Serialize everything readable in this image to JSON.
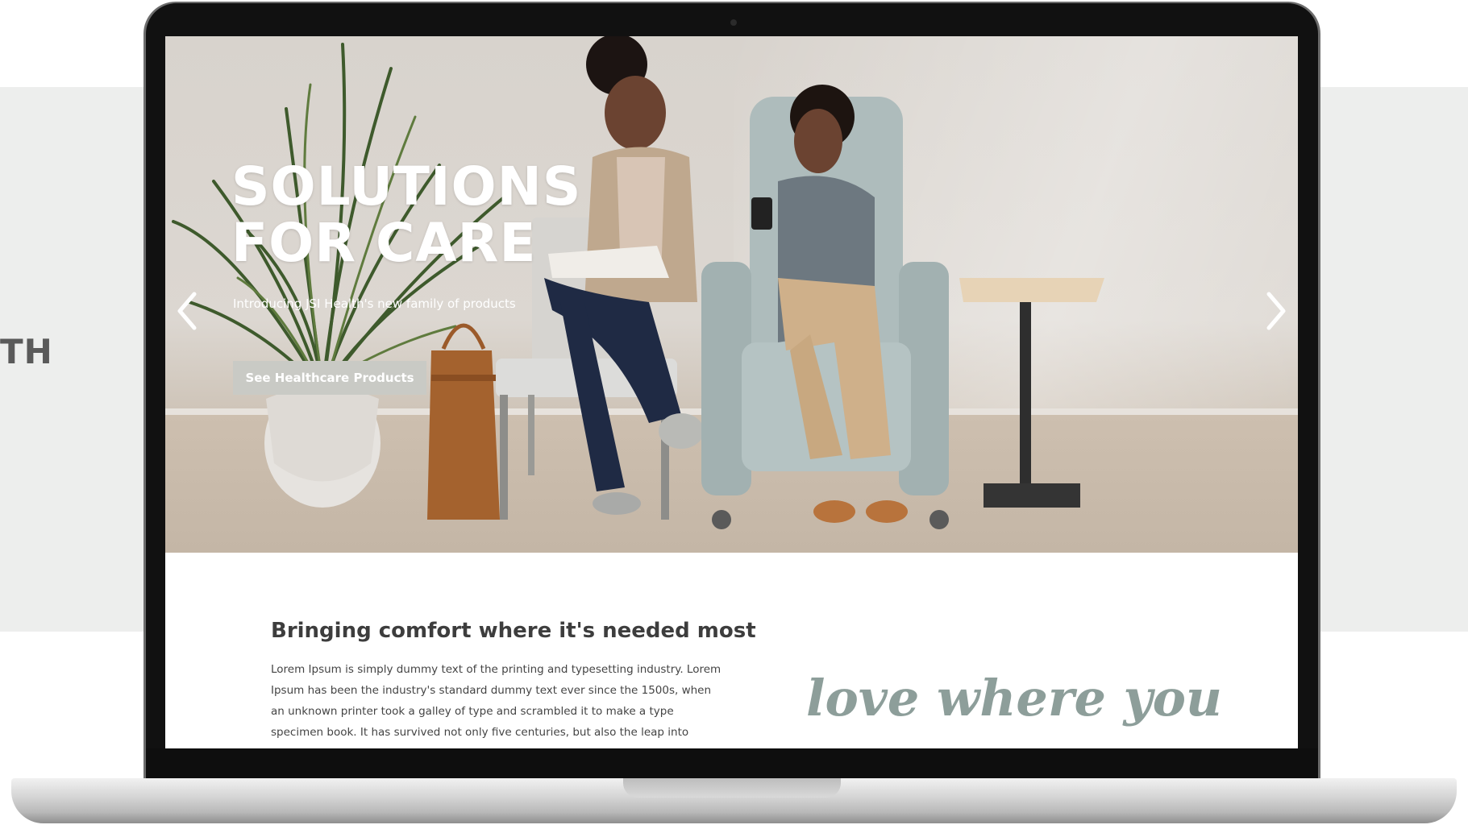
{
  "background": {
    "side_text": "TH"
  },
  "hero": {
    "title_line1": "SOLUTIONS",
    "title_line2": "FOR CARE",
    "subtitle": "Introducing JSI Health's new family of products",
    "cta_label": "See Healthcare Products",
    "prev_icon": "chevron-left-icon",
    "next_icon": "chevron-right-icon"
  },
  "content": {
    "heading": "Bringing comfort where it's needed most",
    "body": "Lorem Ipsum is simply dummy text of the printing and typesetting industry. Lorem Ipsum has been the industry's standard dummy text ever since the 1500s, when an unknown printer took a galley of type and scrambled it to make a type specimen book. It has survived not only five centuries, but also the leap into",
    "script_text": "love where you"
  },
  "colors": {
    "hero_button": "#c9cac5",
    "script_text": "#8d9e9a",
    "heading": "#3d3d3d"
  }
}
